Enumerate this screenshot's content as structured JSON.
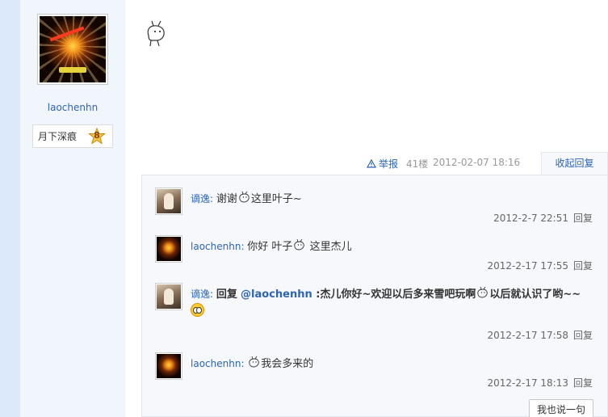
{
  "sidebar": {
    "username": "laochenhn",
    "rank_title": "月下深痕",
    "rank_level": "8"
  },
  "post_meta": {
    "report_label": "举报",
    "floor": "41楼",
    "timestamp": "2012-02-07 18:16",
    "collapse_label": "收起回复"
  },
  "replies": [
    {
      "author": "谪逸",
      "text_before": "谢谢",
      "text_after": "这里叶子~",
      "time": "2012-2-7 22:51",
      "reply_label": "回复"
    },
    {
      "author": "laochenhn",
      "text_before": "你好 叶子",
      "text_after": " 这里杰儿",
      "time": "2012-2-17 17:55",
      "reply_label": "回复"
    },
    {
      "author": "谪逸",
      "prefix": "回复",
      "mention": "@laochenhn",
      "text_before": " :杰儿你好~欢迎以后多来雪吧玩啊",
      "text_after": "以后就认识了哟~~",
      "time": "2012-2-17 17:58",
      "reply_label": "回复"
    },
    {
      "author": "laochenhn",
      "text_after": "我会多来的",
      "time": "2012-2-17 18:13",
      "reply_label": "回复"
    }
  ],
  "say_button_label": "我也说一句",
  "colors": {
    "link_blue": "#2d64b3",
    "sidebar_bg": "#f1f6fc",
    "left_stripe": "#dbe9fb",
    "reply_box_bg": "#f6f8fb"
  },
  "icons": {
    "report": "warning-triangle-icon",
    "rank_badge": "star-badge-icon",
    "emoticon": "rabbit-emoticon-icon"
  }
}
